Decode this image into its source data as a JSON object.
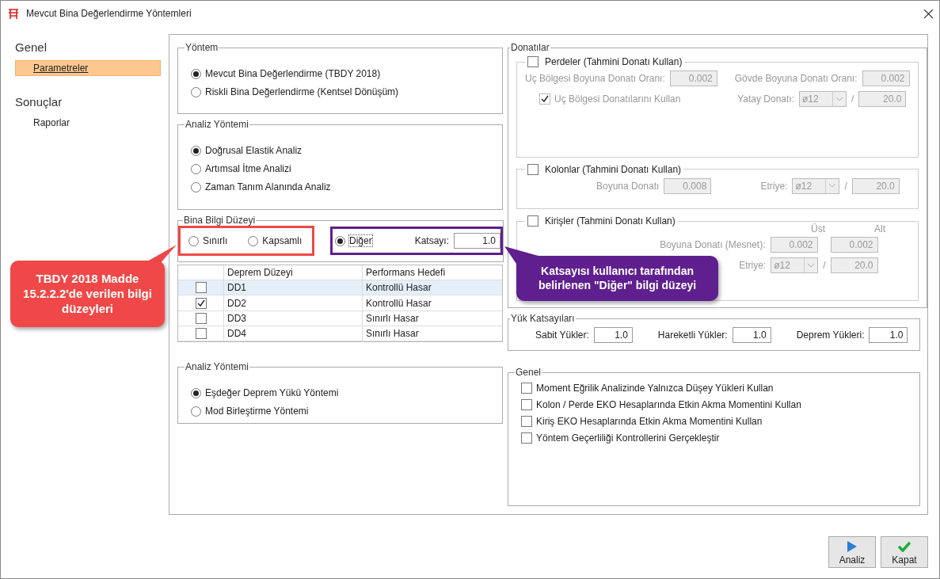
{
  "window": {
    "title": "Mevcut Bina Değerlendirme Yöntemleri"
  },
  "sidebar": [
    {
      "title": "Genel",
      "items": [
        {
          "label": "Parametreler",
          "selected": true
        }
      ]
    },
    {
      "title": "Sonuçlar",
      "items": [
        {
          "label": "Raporlar",
          "selected": false
        }
      ]
    }
  ],
  "yontem": {
    "title": "Yöntem",
    "options": [
      {
        "label": "Mevcut Bina Değerlendirme (TBDY 2018)",
        "selected": true
      },
      {
        "label": "Riskli Bina Değerlendirme (Kentsel Dönüşüm)",
        "selected": false
      }
    ]
  },
  "analiz_yontemi": {
    "title": "Analiz Yöntemi",
    "options": [
      {
        "label": "Doğrusal Elastik Analiz",
        "selected": true
      },
      {
        "label": "Artımsal İtme Analizi",
        "selected": false
      },
      {
        "label": "Zaman Tanım Alanında Analiz",
        "selected": false
      }
    ]
  },
  "bina_bilgi_duzeyi": {
    "title": "Bina Bilgi Düzeyi",
    "options": [
      {
        "label": "Sınırlı",
        "selected": false
      },
      {
        "label": "Kapsamlı",
        "selected": false
      },
      {
        "label": "Diğer",
        "selected": true
      }
    ],
    "katsayi_label": "Katsayı:",
    "katsayi_value": "1.0"
  },
  "deprem_table": {
    "columns": [
      "Deprem Düzeyi",
      "Performans Hedefi"
    ],
    "rows": [
      {
        "checked": false,
        "selected": true,
        "cells": [
          "DD1",
          "Kontrollü Hasar"
        ]
      },
      {
        "checked": true,
        "selected": false,
        "cells": [
          "DD2",
          "Kontrollü Hasar"
        ]
      },
      {
        "checked": false,
        "selected": false,
        "cells": [
          "DD3",
          "Sınırlı Hasar"
        ]
      },
      {
        "checked": false,
        "selected": false,
        "cells": [
          "DD4",
          "Sınırlı Hasar"
        ]
      }
    ]
  },
  "analiz_yontemi_2": {
    "title": "Analiz Yöntemi",
    "options": [
      {
        "label": "Eşdeğer Deprem Yükü Yöntemi",
        "selected": true
      },
      {
        "label": "Mod Birleştirme Yöntemi",
        "selected": false
      }
    ]
  },
  "donatilar": {
    "title": "Donatılar",
    "perdeler": {
      "title": "Perdeler (Tahmini Donatı Kullan)",
      "checked": false,
      "uc_label": "Uç Bölgesi Boyuna Donatı Oranı:",
      "uc_value": "0.002",
      "govde_label": "Gövde Boyuna Donatı Oranı:",
      "govde_value": "0.002",
      "uc_check_label": "Uç Bölgesi Donatılarını Kullan",
      "uc_check_checked": true,
      "yatay_label": "Yatay Donatı:",
      "yatay_select": "ø12",
      "slash": "/",
      "yatay_value": "20.0"
    },
    "kolonlar": {
      "title": "Kolonlar (Tahmini Donatı Kullan)",
      "checked": false,
      "boyuna_label": "Boyuna Donatı",
      "boyuna_value": "0.008",
      "etriye_label": "Etriye:",
      "etriye_select": "ø12",
      "slash": "/",
      "etriye_value": "20.0"
    },
    "kirisler": {
      "title": "Kirişler (Tahmini Donatı Kullan)",
      "checked": false,
      "ust_label": "Üst",
      "alt_label": "Alt",
      "boyuna_label": "Boyuna Donatı (Mesnet):",
      "boyuna_ust": "0.002",
      "boyuna_alt": "0.002",
      "etriye_label": "Etriye:",
      "etriye_select": "ø12",
      "slash": "/",
      "etriye_value": "20.0"
    }
  },
  "yuk_katsayilari": {
    "title": "Yük Katsayıları",
    "fields": [
      {
        "label": "Sabit Yükler:",
        "value": "1.0"
      },
      {
        "label": "Hareketli Yükler:",
        "value": "1.0"
      },
      {
        "label": "Deprem Yükleri:",
        "value": "1.0"
      }
    ]
  },
  "genel": {
    "title": "Genel",
    "options": [
      {
        "label": "Moment Eğrilik Analizinde Yalnızca Düşey Yükleri Kullan",
        "checked": false
      },
      {
        "label": "Kolon / Perde EKO Hesaplarında Etkin Akma Momentini Kullan",
        "checked": false
      },
      {
        "label": "Kiriş EKO Hesaplarında Etkin Akma Momentini Kullan",
        "checked": false
      },
      {
        "label": "Yöntem Geçerliliği Kontrollerini Gerçekleştir",
        "checked": false
      }
    ]
  },
  "buttons": [
    {
      "label": "Analiz",
      "kind": "play"
    },
    {
      "label": "Kapat",
      "kind": "check"
    }
  ],
  "callouts": [
    {
      "text": "TBDY 2018 Madde 15.2.2.2'de verilen bilgi düzeyleri",
      "color": "#f04848"
    },
    {
      "text": "Katsayısı kullanıcı tarafından belirlenen \"Diğer\" bilgi düzeyi",
      "color": "#5f1f8f"
    }
  ]
}
